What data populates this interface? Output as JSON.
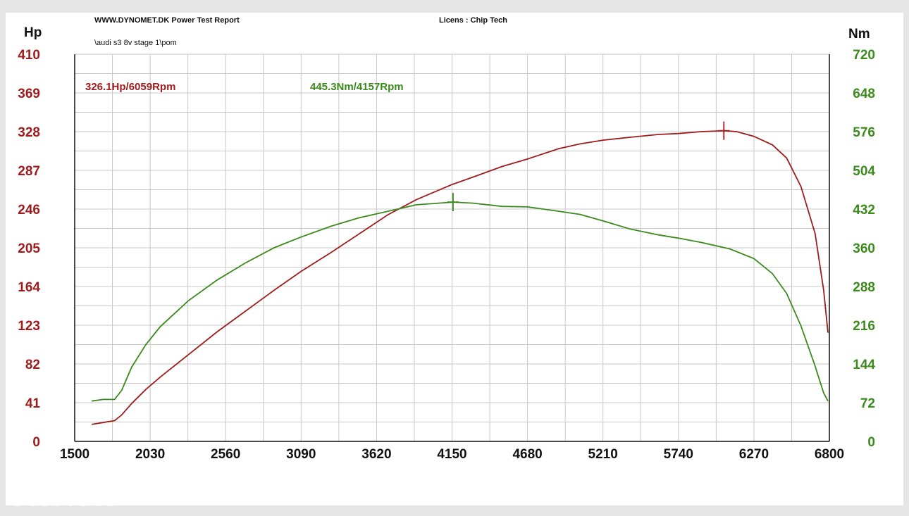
{
  "header": {
    "site_title": "WWW.DYNOMET.DK  Power Test Report",
    "license": "Licens :  Chip Tech",
    "file_path": "\\audi s3 8v stage 1\\pom",
    "left_unit": "Hp",
    "right_unit": "Nm"
  },
  "watermark": "otoMoto",
  "colors": {
    "power": "#a01c1c",
    "torque": "#3a8a1c",
    "grid": "#c8c8c8",
    "axis": "#111111"
  },
  "chart_data": {
    "type": "line",
    "title": "",
    "xlabel": "",
    "x_ticks": [
      1500,
      2030,
      2560,
      3090,
      3620,
      4150,
      4680,
      5210,
      5740,
      6270,
      6800
    ],
    "xlim": [
      1500,
      6800
    ],
    "y_left": {
      "label": "Hp",
      "ticks": [
        0,
        41,
        82,
        123,
        164,
        205,
        246,
        287,
        328,
        369,
        410
      ],
      "lim": [
        0,
        410
      ]
    },
    "y_right": {
      "label": "Nm",
      "ticks": [
        0,
        72,
        144,
        216,
        288,
        360,
        432,
        504,
        576,
        648,
        720
      ],
      "lim": [
        0,
        720
      ]
    },
    "grid": true,
    "annotations": [
      {
        "text": "326.1Hp/6059Rpm",
        "series": "power",
        "x": 6059,
        "y": 326.1
      },
      {
        "text": "445.3Nm/4157Rpm",
        "series": "torque",
        "x": 4157,
        "y": 445.3
      }
    ],
    "series": [
      {
        "id": "power",
        "axis": "left",
        "points": [
          [
            1620,
            18
          ],
          [
            1700,
            20
          ],
          [
            1780,
            22
          ],
          [
            1830,
            28
          ],
          [
            1900,
            40
          ],
          [
            2000,
            55
          ],
          [
            2100,
            68
          ],
          [
            2300,
            92
          ],
          [
            2500,
            116
          ],
          [
            2700,
            138
          ],
          [
            2900,
            160
          ],
          [
            3090,
            180
          ],
          [
            3300,
            200
          ],
          [
            3500,
            220
          ],
          [
            3700,
            240
          ],
          [
            3900,
            256
          ],
          [
            4150,
            272
          ],
          [
            4300,
            280
          ],
          [
            4500,
            291
          ],
          [
            4680,
            299
          ],
          [
            4900,
            310
          ],
          [
            5050,
            315
          ],
          [
            5210,
            319
          ],
          [
            5400,
            322
          ],
          [
            5600,
            325
          ],
          [
            5740,
            326
          ],
          [
            5900,
            328
          ],
          [
            6059,
            329
          ],
          [
            6150,
            328
          ],
          [
            6270,
            323
          ],
          [
            6400,
            314
          ],
          [
            6500,
            300
          ],
          [
            6600,
            270
          ],
          [
            6700,
            220
          ],
          [
            6760,
            160
          ],
          [
            6790,
            115
          ]
        ]
      },
      {
        "id": "torque",
        "axis": "right",
        "points": [
          [
            1620,
            75
          ],
          [
            1700,
            78
          ],
          [
            1780,
            78
          ],
          [
            1830,
            95
          ],
          [
            1900,
            138
          ],
          [
            2000,
            180
          ],
          [
            2100,
            213
          ],
          [
            2300,
            262
          ],
          [
            2500,
            300
          ],
          [
            2700,
            332
          ],
          [
            2900,
            360
          ],
          [
            3090,
            380
          ],
          [
            3300,
            400
          ],
          [
            3500,
            416
          ],
          [
            3700,
            428
          ],
          [
            3900,
            440
          ],
          [
            4157,
            445
          ],
          [
            4300,
            443
          ],
          [
            4500,
            437
          ],
          [
            4680,
            436
          ],
          [
            4900,
            428
          ],
          [
            5050,
            422
          ],
          [
            5210,
            410
          ],
          [
            5400,
            395
          ],
          [
            5600,
            384
          ],
          [
            5740,
            378
          ],
          [
            5900,
            370
          ],
          [
            6100,
            358
          ],
          [
            6270,
            340
          ],
          [
            6400,
            312
          ],
          [
            6500,
            275
          ],
          [
            6600,
            215
          ],
          [
            6700,
            140
          ],
          [
            6760,
            90
          ],
          [
            6790,
            75
          ]
        ]
      }
    ],
    "peak_markers": [
      {
        "series": "power",
        "x": 6059,
        "y": 329
      },
      {
        "series": "torque",
        "x": 4157,
        "y": 445
      }
    ]
  }
}
